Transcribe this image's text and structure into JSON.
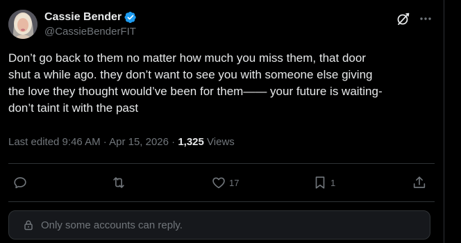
{
  "author": {
    "display_name": "Cassie Bender",
    "handle": "@CassieBenderFIT",
    "verified": true,
    "verified_color": "#1d9bf0"
  },
  "icons": {
    "avatar": "profile-photo",
    "verified": "verified-badge-icon",
    "grok": "grok-icon",
    "more": "more-options-icon",
    "reply": "reply-icon",
    "repost": "repost-icon",
    "like": "heart-icon",
    "bookmark": "bookmark-icon",
    "share": "share-icon",
    "lock": "lock-icon"
  },
  "tweet": {
    "lines": [
      "Don’t go back to them no matter how much you miss them, that door",
      "shut a while ago. they don’t want to see you with someone else giving",
      "the love they thought would’ve been for them—— your future is waiting-",
      "don’t taint it with the past"
    ]
  },
  "meta": {
    "edited_label": "Last edited 9:46 AM · Apr 15, 2026 · ",
    "views_count": "1,325",
    "views_label": " Views"
  },
  "actions": {
    "reply_count": "",
    "repost_count": "",
    "like_count": "17",
    "bookmark_count": "1"
  },
  "reply_restriction": {
    "text": "Only some accounts can reply."
  },
  "colors": {
    "background": "#000000",
    "text_primary": "#e7e9ea",
    "text_secondary": "#71767b",
    "border": "#2f3336",
    "accent": "#1d9bf0"
  }
}
